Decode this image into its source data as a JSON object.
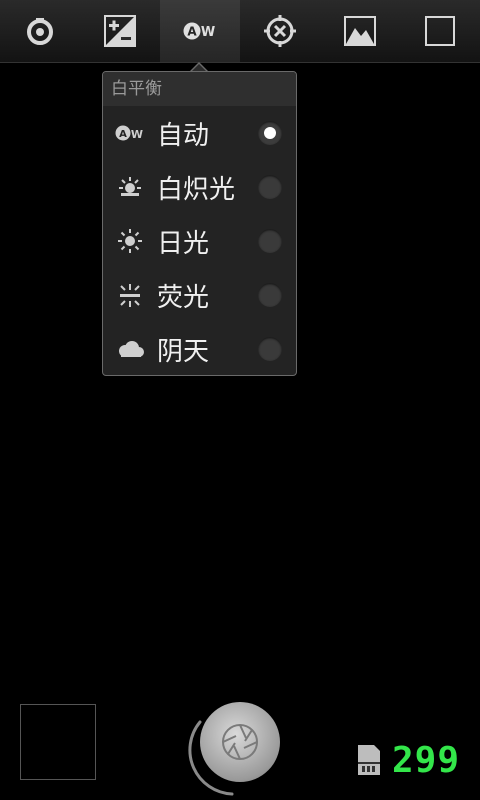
{
  "toolbar": {
    "buttons": [
      {
        "icon": "settings-dial-icon"
      },
      {
        "icon": "exposure-icon"
      },
      {
        "icon": "white-balance-auto-icon",
        "active": true,
        "label": "AW"
      },
      {
        "icon": "focus-crosshair-icon"
      },
      {
        "icon": "scene-landscape-icon"
      },
      {
        "icon": "square-frame-icon"
      }
    ]
  },
  "popup": {
    "title": "白平衡",
    "items": [
      {
        "label": "自动",
        "icon": "auto-wb-icon",
        "icon_text": "AW",
        "checked": true
      },
      {
        "label": "白炽光",
        "icon": "incandescent-icon",
        "checked": false
      },
      {
        "label": "日光",
        "icon": "daylight-icon",
        "checked": false
      },
      {
        "label": "荧光",
        "icon": "fluorescent-icon",
        "checked": false
      },
      {
        "label": "阴天",
        "icon": "cloudy-icon",
        "checked": false
      }
    ]
  },
  "bottom": {
    "remaining_count": "299"
  },
  "colors": {
    "count_green": "#33e64a",
    "popup_bg": "#232323"
  }
}
